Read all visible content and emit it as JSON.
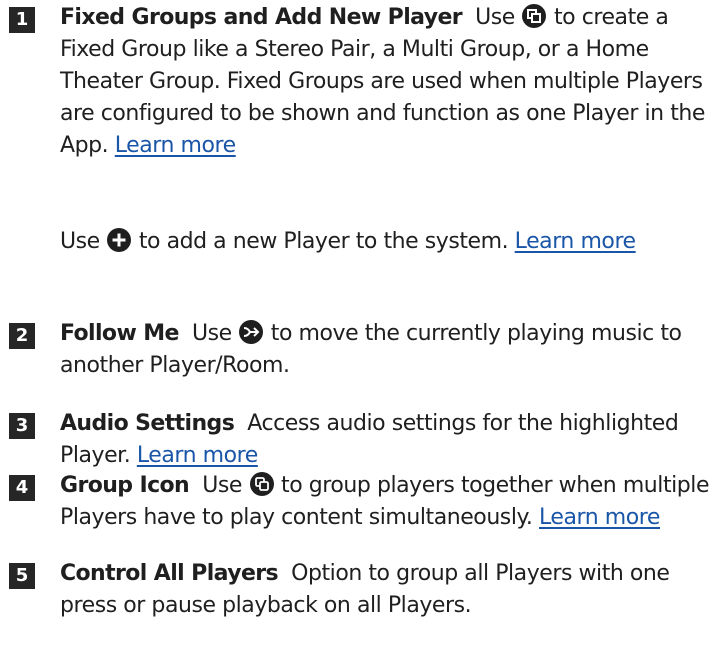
{
  "items": [
    {
      "number": "1",
      "title": "Fixed Groups and Add New Player",
      "p1_before": "Use",
      "p1_icon": "fixed-group-icon",
      "p1_after": "to create a Fixed Group like a Stereo Pair, a Multi Group, or a Home Theater Group. Fixed Groups are used when multiple Players are configured to be shown and function as one Player in the App.",
      "p1_link": "Learn more",
      "p2_before": "Use",
      "p2_icon": "add-player-icon",
      "p2_after": "to add a new Player to the system.",
      "p2_link": "Learn more"
    },
    {
      "number": "2",
      "title": "Follow Me",
      "before": "Use",
      "icon": "follow-me-icon",
      "after": "to move the currently playing music to another Player/Room."
    },
    {
      "number": "3",
      "title": "Audio Settings",
      "text": "Access audio settings for the highlighted Player.",
      "link": "Learn more"
    },
    {
      "number": "4",
      "title": "Group Icon",
      "before": "Use",
      "icon": "group-icon",
      "after": "to group players together when multiple Players have to play content simultaneously.",
      "link": "Learn more"
    },
    {
      "number": "5",
      "title": "Control All Players",
      "text": "Option to group all Players with one press or pause playback on all Players."
    }
  ],
  "colors": {
    "text": "#1f1f1f",
    "badge": "#262626",
    "link": "#1a56a8"
  }
}
